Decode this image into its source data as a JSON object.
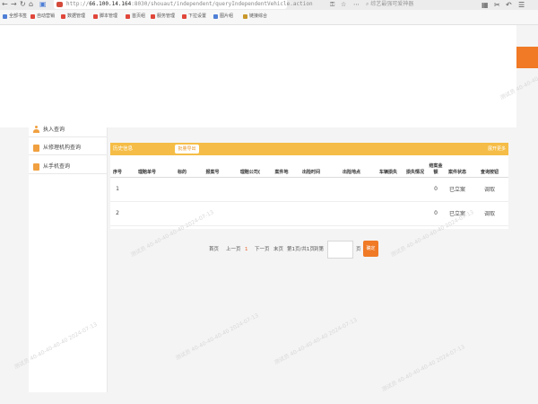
{
  "browser": {
    "url_prefix": "http://",
    "url_host": "66.100.14.164",
    "url_path": ":8030/shouaut/independent/queryIndependentVehicle.action",
    "search_placeholder": "综艺最强可爱神器",
    "bookmarks": [
      {
        "label": "全部书签",
        "color": "#4f7fd6"
      },
      {
        "label": "自动营销",
        "color": "#e0463a"
      },
      {
        "label": "数据管理",
        "color": "#e0463a"
      },
      {
        "label": "脚本管理",
        "color": "#e0463a"
      },
      {
        "label": "首页组",
        "color": "#e0463a"
      },
      {
        "label": "服务管理",
        "color": "#e0463a"
      },
      {
        "label": "下拉设置",
        "color": "#e0463a"
      },
      {
        "label": "图片组",
        "color": "#4f7fd6"
      },
      {
        "label": "链接综合",
        "color": "#c8962a"
      }
    ]
  },
  "sidebar": {
    "items": [
      {
        "label": "执入查询"
      },
      {
        "label": "从修理机构查询"
      },
      {
        "label": "从手机查询"
      }
    ]
  },
  "panel": {
    "title": "历史信息",
    "export_label": "批量导出",
    "toggle_label": "展开更多",
    "columns": [
      "序号",
      "理赔单号",
      "标的",
      "报案号",
      "理赔公司(",
      "案件地",
      "出险时间",
      "出险地点",
      "车辆损失",
      "损失情况",
      "结案金额",
      "案件状态",
      "查询按钮"
    ],
    "rows": [
      {
        "index": "1",
        "amount": "0",
        "status": "已立案",
        "action": "调取"
      },
      {
        "index": "2",
        "amount": "0",
        "status": "已立案",
        "action": "调取"
      }
    ]
  },
  "pagination": {
    "first": "首页",
    "prev": "上一页",
    "current": "1",
    "next": "下一页",
    "last": "末页",
    "info": "第1页/共1页",
    "jump_label": "到第",
    "page_unit": "页",
    "go_label": "确定"
  },
  "watermark": "测试员 40-40-40-40-40 2024-07-13",
  "colors": {
    "accent": "#f07a26",
    "panel_header": "#f5bd47"
  }
}
